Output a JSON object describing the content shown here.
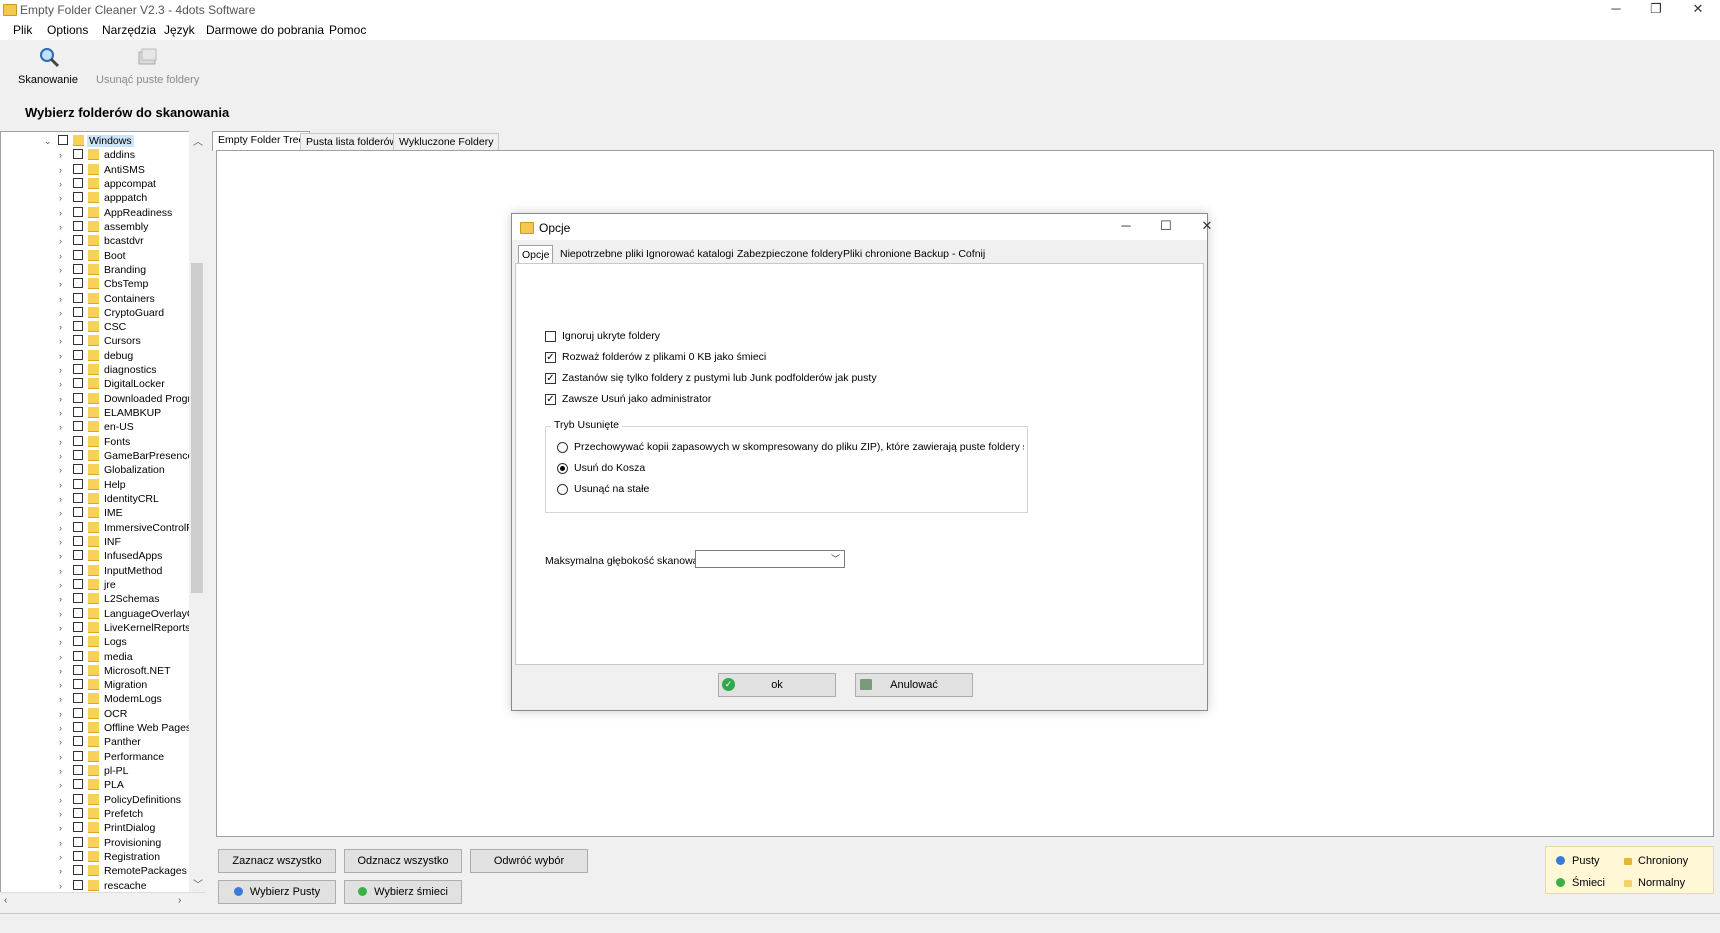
{
  "window": {
    "title": "Empty Folder Cleaner V2.3 - 4dots Software",
    "controls": {
      "minimize": "─",
      "maximize": "❐",
      "close": "✕"
    }
  },
  "menu": [
    "Plik",
    "Options",
    "Narzędzia",
    "Język",
    "Darmowe do pobrania",
    "Pomoc"
  ],
  "toolbar": {
    "scan_label": "Skanowanie",
    "delete_label": "Usunąć puste foldery"
  },
  "heading": "Wybierz folderów do skanowania",
  "tree": {
    "root": "Windows",
    "items": [
      "addins",
      "AntiSMS",
      "appcompat",
      "apppatch",
      "AppReadiness",
      "assembly",
      "bcastdvr",
      "Boot",
      "Branding",
      "CbsTemp",
      "Containers",
      "CryptoGuard",
      "CSC",
      "Cursors",
      "debug",
      "diagnostics",
      "DigitalLocker",
      "Downloaded Program",
      "ELAMBKUP",
      "en-US",
      "Fonts",
      "GameBarPresenceW",
      "Globalization",
      "Help",
      "IdentityCRL",
      "IME",
      "ImmersiveControlPan",
      "INF",
      "InfusedApps",
      "InputMethod",
      "jre",
      "L2Schemas",
      "LanguageOverlayCa",
      "LiveKernelReports",
      "Logs",
      "media",
      "Microsoft.NET",
      "Migration",
      "ModemLogs",
      "OCR",
      "Offline Web Pages",
      "Panther",
      "Performance",
      "pl-PL",
      "PLA",
      "PolicyDefinitions",
      "Prefetch",
      "PrintDialog",
      "Provisioning",
      "Registration",
      "RemotePackages",
      "rescache"
    ]
  },
  "tabs": [
    "Empty Folder Tree",
    "Pusta lista folderów",
    "Wykluczone Foldery"
  ],
  "buttons": {
    "select_all": "Zaznacz wszystko",
    "deselect_all": "Odznacz wszystko",
    "invert": "Odwróć wybór",
    "select_empty": "Wybierz Pusty",
    "select_junk": "Wybierz śmieci"
  },
  "legend": {
    "empty": "Pusty",
    "protected": "Chroniony",
    "junk": "Śmieci",
    "normal": "Normalny"
  },
  "colors": {
    "empty_dot": "#3a7bd5",
    "junk_dot": "#3cb043",
    "lock": "#e2b63a"
  },
  "dialog": {
    "title": "Opcje",
    "tabs": [
      "Opcje",
      "Niepotrzebne pliki",
      "Ignorować katalogi",
      "Zabezpieczone foldery",
      "Pliki chronione",
      "Backup - Cofnij"
    ],
    "checkboxes": [
      {
        "label": "Ignoruj ukryte foldery",
        "checked": false
      },
      {
        "label": "Rozważ folderów z plikami 0 KB jako śmieci",
        "checked": true
      },
      {
        "label": "Zastanów się tylko foldery z pustymi lub Junk podfolderów jak pusty",
        "checked": true
      },
      {
        "label": "Zawsze Usuń jako administrator",
        "checked": true
      }
    ],
    "group_title": "Tryb Usunięte",
    "radios": [
      {
        "label": "Przechowywać kopii zapasowych w skompresowany do pliku ZIP), które zawierają puste foldery są usuwane",
        "checked": false
      },
      {
        "label": "Usuń do Kosza",
        "checked": true
      },
      {
        "label": "Usunąć na stałe",
        "checked": false
      }
    ],
    "depth_label": "Maksymalna głębokość skanowania folderów:",
    "depth_value": "",
    "ok": "ok",
    "cancel": "Anulować"
  }
}
